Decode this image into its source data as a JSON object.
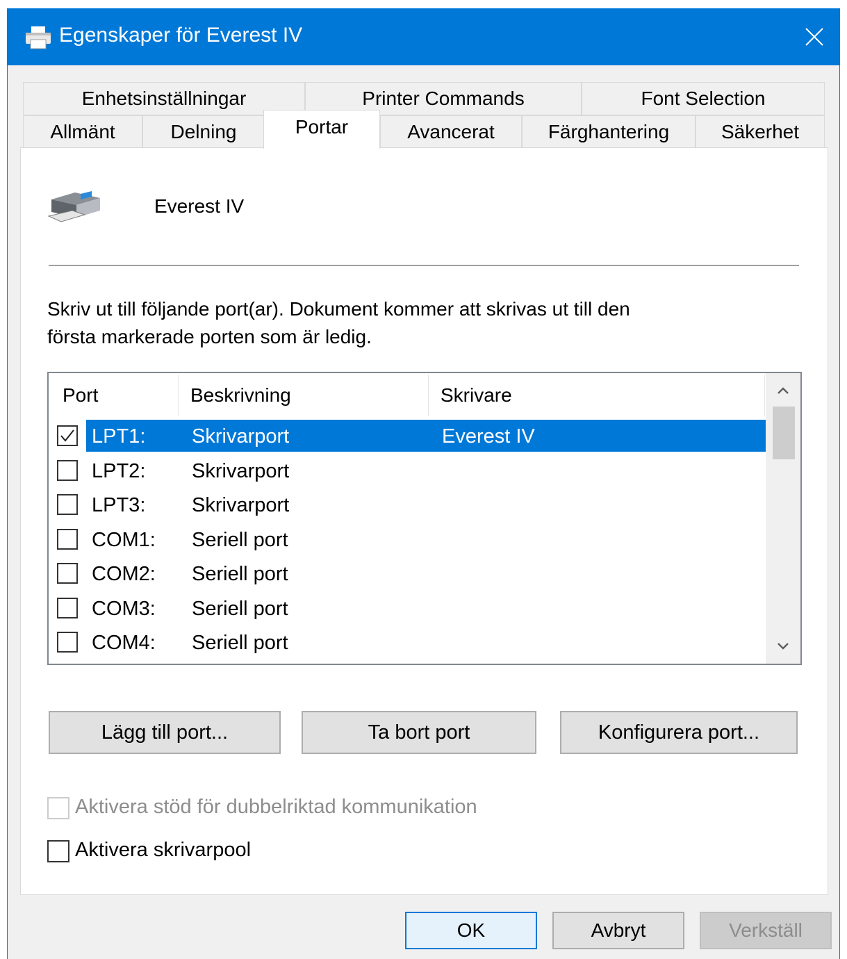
{
  "window": {
    "title": "Egenskaper för Everest IV"
  },
  "tabs_row1": [
    {
      "label": "Enhetsinställningar"
    },
    {
      "label": "Printer Commands"
    },
    {
      "label": "Font Selection"
    }
  ],
  "tabs_row2": [
    {
      "label": "Allmänt"
    },
    {
      "label": "Delning"
    },
    {
      "label": "Portar",
      "active": true
    },
    {
      "label": "Avancerat"
    },
    {
      "label": "Färghantering"
    },
    {
      "label": "Säkerhet"
    }
  ],
  "printer": {
    "name": "Everest IV",
    "icon": "printer-icon"
  },
  "description": {
    "line1": "Skriv ut till följande port(ar). Dokument kommer att skrivas ut till den",
    "line2": "första markerade porten som är ledig."
  },
  "port_list": {
    "headers": {
      "port": "Port",
      "beskrivning": "Beskrivning",
      "skrivare": "Skrivare"
    },
    "rows": [
      {
        "port": "LPT1:",
        "beskrivning": "Skrivarport",
        "skrivare": "Everest IV",
        "checked": true,
        "selected": true
      },
      {
        "port": "LPT2:",
        "beskrivning": "Skrivarport",
        "skrivare": "",
        "checked": false,
        "selected": false
      },
      {
        "port": "LPT3:",
        "beskrivning": "Skrivarport",
        "skrivare": "",
        "checked": false,
        "selected": false
      },
      {
        "port": "COM1:",
        "beskrivning": "Seriell port",
        "skrivare": "",
        "checked": false,
        "selected": false
      },
      {
        "port": "COM2:",
        "beskrivning": "Seriell port",
        "skrivare": "",
        "checked": false,
        "selected": false
      },
      {
        "port": "COM3:",
        "beskrivning": "Seriell port",
        "skrivare": "",
        "checked": false,
        "selected": false
      },
      {
        "port": "COM4:",
        "beskrivning": "Seriell port",
        "skrivare": "",
        "checked": false,
        "selected": false
      }
    ]
  },
  "port_buttons": {
    "add": "Lägg till port...",
    "remove": "Ta bort port",
    "configure": "Konfigurera port..."
  },
  "options": {
    "bidirectional": {
      "label": "Aktivera stöd för dubbelriktad kommunikation",
      "checked": false,
      "enabled": false
    },
    "pool": {
      "label": "Aktivera skrivarpool",
      "checked": false,
      "enabled": true
    }
  },
  "footer": {
    "ok": "OK",
    "cancel": "Avbryt",
    "apply": "Verkställ"
  },
  "colors": {
    "titlebar": "#0078d7",
    "selection": "#0078d7",
    "dialog_bg": "#f0f0f0"
  }
}
